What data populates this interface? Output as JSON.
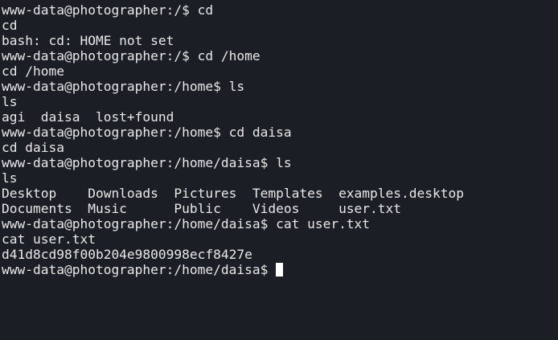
{
  "terminal": {
    "lines": [
      "www-data@photographer:/$ cd",
      "cd",
      "bash: cd: HOME not set",
      "www-data@photographer:/$ cd /home",
      "cd /home",
      "www-data@photographer:/home$ ls",
      "ls",
      "agi  daisa  lost+found",
      "www-data@photographer:/home$ cd daisa",
      "cd daisa",
      "www-data@photographer:/home/daisa$ ls",
      "ls",
      "Desktop    Downloads  Pictures  Templates  examples.desktop",
      "Documents  Music      Public    Videos     user.txt",
      "www-data@photographer:/home/daisa$ cat user.txt",
      "cat user.txt",
      "d41d8cd98f00b204e9800998ecf8427e"
    ],
    "prompt": "www-data@photographer:/home/daisa$ "
  }
}
